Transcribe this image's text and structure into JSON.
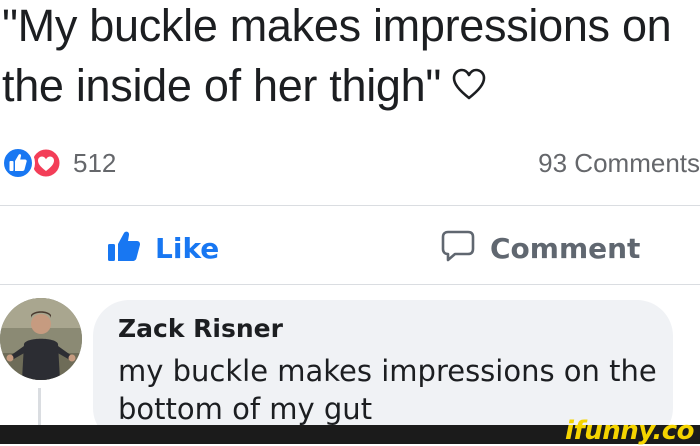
{
  "post": {
    "text": "\"My buckle makes impressions on the inside of her thigh\"",
    "trailing_icon": "heart-outline-icon"
  },
  "reactions": {
    "icons": [
      "like-reaction-icon",
      "love-reaction-icon"
    ],
    "count": "512",
    "comments_label": "93 Comments"
  },
  "actions": {
    "like_label": "Like",
    "comment_label": "Comment"
  },
  "comment": {
    "author": "Zack Risner",
    "text": "my buckle makes impressions on the bottom of my gut"
  },
  "watermark": {
    "text": "ifunny.co"
  },
  "colors": {
    "link_blue": "#1877f2",
    "love_red": "#f33e58",
    "muted_gray": "#65676b",
    "bubble_bg": "#f0f2f5",
    "watermark_yellow": "#f5d400"
  }
}
